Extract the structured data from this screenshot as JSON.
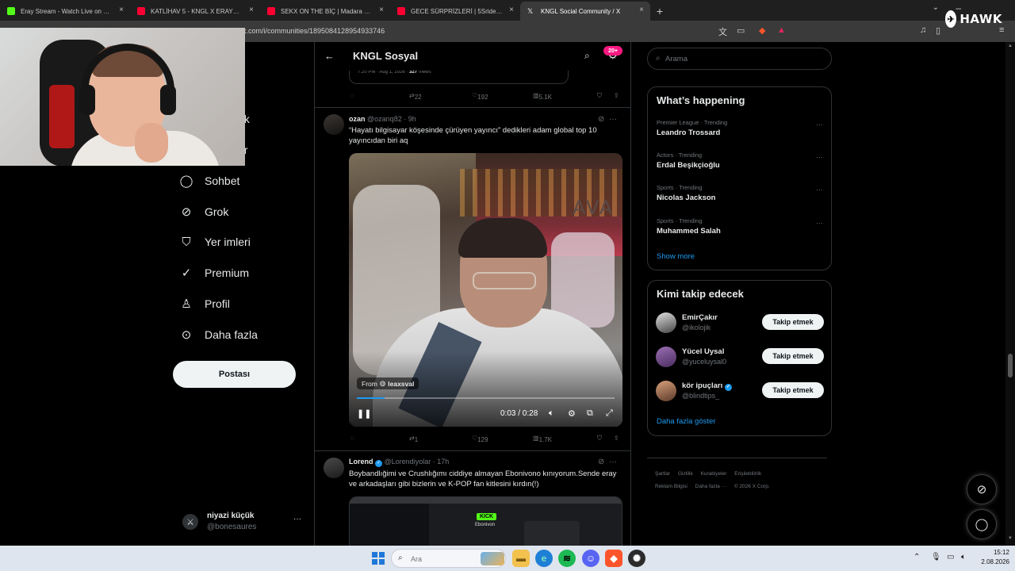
{
  "browser": {
    "tabs": [
      {
        "label": "Eray Stream - Watch Live on Kick",
        "color": "#53fc18",
        "active": false
      },
      {
        "label": "KATLİHAV 5 - KNGL X ERAY067 & MAD",
        "color": "#ff0033",
        "active": false
      },
      {
        "label": "SEKX ON THE BİÇ | Madara Olduk #7",
        "color": "#ff0033",
        "active": false
      },
      {
        "label": "GECE SÜRPRİZLERİ | 5Sriders | Motosik",
        "color": "#ff0033",
        "active": false
      },
      {
        "label": "KNGL Social Community / X",
        "color": "#ffffff",
        "active": true
      }
    ],
    "new_tab": "+",
    "url": "x.com/i/communities/1895084128954933746",
    "overlay_logo": "HAWK"
  },
  "nav": {
    "partials": [
      "ek",
      "er"
    ],
    "items": [
      {
        "label": "Sohbet",
        "icon": "chat-icon"
      },
      {
        "label": "Grok",
        "icon": "grok-icon"
      },
      {
        "label": "Yer imleri",
        "icon": "bookmark-icon"
      },
      {
        "label": "Premium",
        "icon": "verified-icon"
      },
      {
        "label": "Profil",
        "icon": "person-icon"
      },
      {
        "label": "Daha fazla",
        "icon": "more-circle-icon"
      }
    ],
    "post_button": "Postası",
    "account": {
      "name": "niyazi küçük",
      "handle": "@bonesaures",
      "more": "···"
    }
  },
  "main": {
    "title": "KNGL Sosyal",
    "notif_badge": "20+",
    "quoted_meta": {
      "time": "7:20 PM · Aug 1, 2026 · ",
      "views": "327",
      "views_label": " Views"
    },
    "first_actions": {
      "retweets": "22",
      "likes": "192",
      "views": "5.1K"
    },
    "post1": {
      "name": "ozan",
      "handle": "@ozanq82 · 9h",
      "text": "“Hayatı bilgisayar köşesinde çürüyen yayıncı” dedikleri adam global top 10 yayıncıdan biri aq",
      "video": {
        "source_prefix": "From",
        "source_name": "leaxsval",
        "time": "0:03 / 0:28",
        "progress": 0.107,
        "watermark": "AVA"
      },
      "actions": {
        "replies": "",
        "retweets": "1",
        "likes": "129",
        "views": "1.7K"
      }
    },
    "post2": {
      "name": "Lorend",
      "handle": "@Lorendiyolar · 17h",
      "text": "Boybandlığimi ve Crushlığımı ciddiye almayan Ebonivono kınıyorum.Sende eray ve arkadaşları gibi bizlerin ve K-POP fan kitlesini kırdın(!)",
      "thumb_kick": "KICK",
      "thumb_name": "Ebonivon"
    }
  },
  "sidebar": {
    "search_placeholder": "Arama",
    "whats_happening": {
      "title": "What’s happening",
      "trends": [
        {
          "meta": "Premier League · Trending",
          "name": "Leandro Trossard"
        },
        {
          "meta": "Actors · Trending",
          "name": "Erdal Beşikçioğlu"
        },
        {
          "meta": "Sports · Trending",
          "name": "Nicolas Jackson"
        },
        {
          "meta": "Sports · Trending",
          "name": "Muhammed Salah"
        }
      ],
      "show_more": "Show more"
    },
    "who_to_follow": {
      "title": "Kimi takip edecek",
      "accounts": [
        {
          "name": "EmirÇakır",
          "handle": "@ikolojik",
          "button": "Takip etmek",
          "verified": false
        },
        {
          "name": "Yücel Uysal",
          "handle": "@yuceluysal0",
          "button": "Takip etmek",
          "verified": false
        },
        {
          "name": "kör ipuçları",
          "handle": "@blindtips_",
          "button": "Takip etmek",
          "verified": true
        }
      ],
      "show_more": "Daha fazla göster"
    },
    "footer": [
      "Şartlar",
      "Gizlilik",
      "Kurabiyeler",
      "Erişilebilirlik",
      "Reklam Bilgisi",
      "Daha fazla ···",
      "© 2026 X Corp."
    ]
  },
  "taskbar": {
    "search_placeholder": "Ara",
    "time": "15:12",
    "date": "2.08.2026"
  },
  "colors": {
    "accent": "#1d9bf0",
    "badge": "#f91880",
    "background": "#000000",
    "border": "#2f3336",
    "muted": "#71767b"
  }
}
